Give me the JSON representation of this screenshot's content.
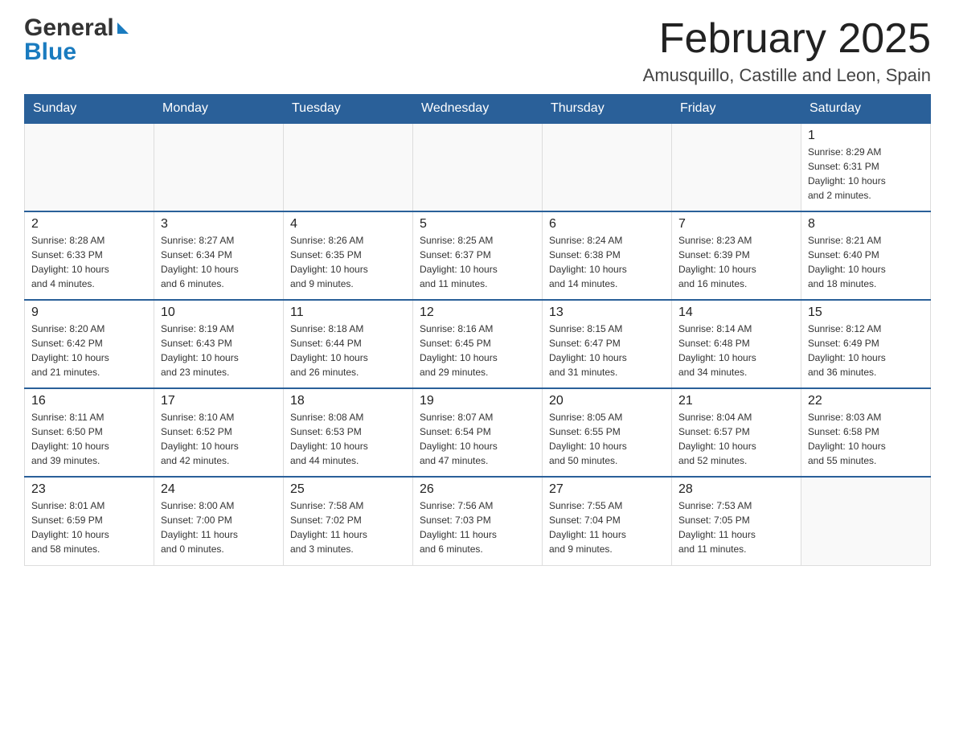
{
  "header": {
    "logo_general": "General",
    "logo_blue": "Blue",
    "month_year": "February 2025",
    "location": "Amusquillo, Castille and Leon, Spain"
  },
  "weekdays": [
    "Sunday",
    "Monday",
    "Tuesday",
    "Wednesday",
    "Thursday",
    "Friday",
    "Saturday"
  ],
  "weeks": [
    [
      {
        "day": "",
        "info": ""
      },
      {
        "day": "",
        "info": ""
      },
      {
        "day": "",
        "info": ""
      },
      {
        "day": "",
        "info": ""
      },
      {
        "day": "",
        "info": ""
      },
      {
        "day": "",
        "info": ""
      },
      {
        "day": "1",
        "info": "Sunrise: 8:29 AM\nSunset: 6:31 PM\nDaylight: 10 hours\nand 2 minutes."
      }
    ],
    [
      {
        "day": "2",
        "info": "Sunrise: 8:28 AM\nSunset: 6:33 PM\nDaylight: 10 hours\nand 4 minutes."
      },
      {
        "day": "3",
        "info": "Sunrise: 8:27 AM\nSunset: 6:34 PM\nDaylight: 10 hours\nand 6 minutes."
      },
      {
        "day": "4",
        "info": "Sunrise: 8:26 AM\nSunset: 6:35 PM\nDaylight: 10 hours\nand 9 minutes."
      },
      {
        "day": "5",
        "info": "Sunrise: 8:25 AM\nSunset: 6:37 PM\nDaylight: 10 hours\nand 11 minutes."
      },
      {
        "day": "6",
        "info": "Sunrise: 8:24 AM\nSunset: 6:38 PM\nDaylight: 10 hours\nand 14 minutes."
      },
      {
        "day": "7",
        "info": "Sunrise: 8:23 AM\nSunset: 6:39 PM\nDaylight: 10 hours\nand 16 minutes."
      },
      {
        "day": "8",
        "info": "Sunrise: 8:21 AM\nSunset: 6:40 PM\nDaylight: 10 hours\nand 18 minutes."
      }
    ],
    [
      {
        "day": "9",
        "info": "Sunrise: 8:20 AM\nSunset: 6:42 PM\nDaylight: 10 hours\nand 21 minutes."
      },
      {
        "day": "10",
        "info": "Sunrise: 8:19 AM\nSunset: 6:43 PM\nDaylight: 10 hours\nand 23 minutes."
      },
      {
        "day": "11",
        "info": "Sunrise: 8:18 AM\nSunset: 6:44 PM\nDaylight: 10 hours\nand 26 minutes."
      },
      {
        "day": "12",
        "info": "Sunrise: 8:16 AM\nSunset: 6:45 PM\nDaylight: 10 hours\nand 29 minutes."
      },
      {
        "day": "13",
        "info": "Sunrise: 8:15 AM\nSunset: 6:47 PM\nDaylight: 10 hours\nand 31 minutes."
      },
      {
        "day": "14",
        "info": "Sunrise: 8:14 AM\nSunset: 6:48 PM\nDaylight: 10 hours\nand 34 minutes."
      },
      {
        "day": "15",
        "info": "Sunrise: 8:12 AM\nSunset: 6:49 PM\nDaylight: 10 hours\nand 36 minutes."
      }
    ],
    [
      {
        "day": "16",
        "info": "Sunrise: 8:11 AM\nSunset: 6:50 PM\nDaylight: 10 hours\nand 39 minutes."
      },
      {
        "day": "17",
        "info": "Sunrise: 8:10 AM\nSunset: 6:52 PM\nDaylight: 10 hours\nand 42 minutes."
      },
      {
        "day": "18",
        "info": "Sunrise: 8:08 AM\nSunset: 6:53 PM\nDaylight: 10 hours\nand 44 minutes."
      },
      {
        "day": "19",
        "info": "Sunrise: 8:07 AM\nSunset: 6:54 PM\nDaylight: 10 hours\nand 47 minutes."
      },
      {
        "day": "20",
        "info": "Sunrise: 8:05 AM\nSunset: 6:55 PM\nDaylight: 10 hours\nand 50 minutes."
      },
      {
        "day": "21",
        "info": "Sunrise: 8:04 AM\nSunset: 6:57 PM\nDaylight: 10 hours\nand 52 minutes."
      },
      {
        "day": "22",
        "info": "Sunrise: 8:03 AM\nSunset: 6:58 PM\nDaylight: 10 hours\nand 55 minutes."
      }
    ],
    [
      {
        "day": "23",
        "info": "Sunrise: 8:01 AM\nSunset: 6:59 PM\nDaylight: 10 hours\nand 58 minutes."
      },
      {
        "day": "24",
        "info": "Sunrise: 8:00 AM\nSunset: 7:00 PM\nDaylight: 11 hours\nand 0 minutes."
      },
      {
        "day": "25",
        "info": "Sunrise: 7:58 AM\nSunset: 7:02 PM\nDaylight: 11 hours\nand 3 minutes."
      },
      {
        "day": "26",
        "info": "Sunrise: 7:56 AM\nSunset: 7:03 PM\nDaylight: 11 hours\nand 6 minutes."
      },
      {
        "day": "27",
        "info": "Sunrise: 7:55 AM\nSunset: 7:04 PM\nDaylight: 11 hours\nand 9 minutes."
      },
      {
        "day": "28",
        "info": "Sunrise: 7:53 AM\nSunset: 7:05 PM\nDaylight: 11 hours\nand 11 minutes."
      },
      {
        "day": "",
        "info": ""
      }
    ]
  ]
}
